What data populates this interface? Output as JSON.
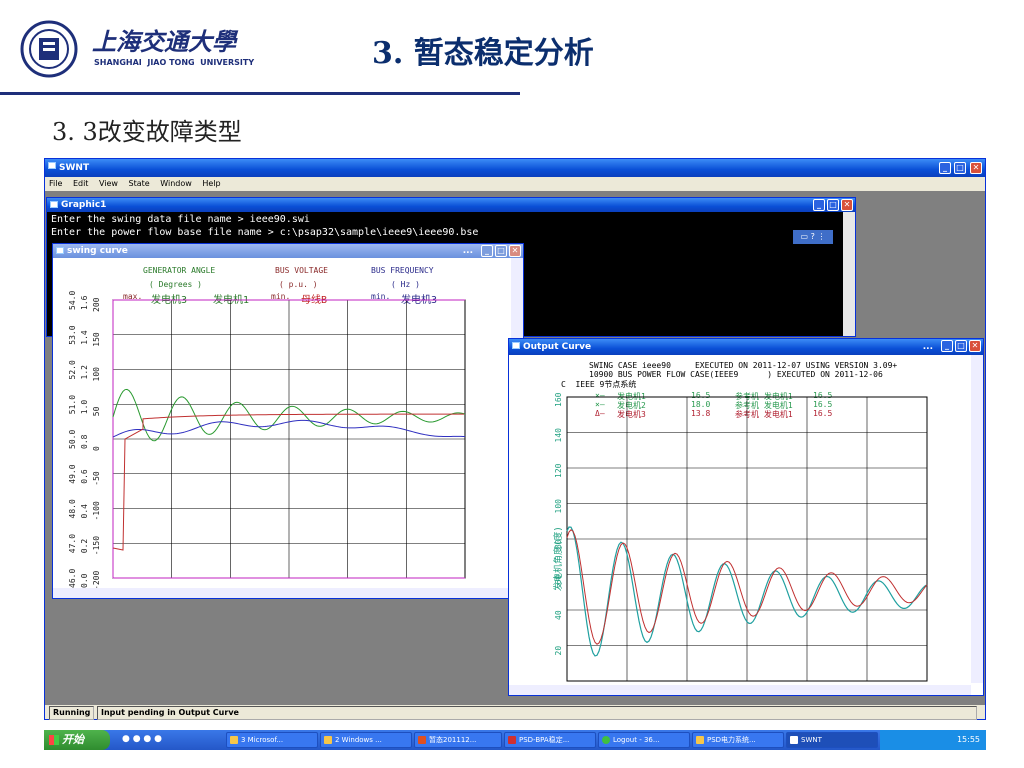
{
  "slide": {
    "logo_cn": "上海交通大學",
    "logo_en": "SHANGHAI  JIAO TONG  UNIVERSITY",
    "title": "3. 暂态稳定分析",
    "subtitle": "3. 3改变故障类型"
  },
  "app": {
    "title": "SWNT",
    "menu": [
      "File",
      "Edit",
      "View",
      "State",
      "Window",
      "Help"
    ],
    "status_state": "Running",
    "status_msg": "Input pending in Output Curve"
  },
  "graphic": {
    "title": "Graphic1",
    "line1": "Enter the swing data file name > ieee90.swi",
    "line2": "Enter the power flow base file name > c:\\psap32\\sample\\ieee9\\ieee90.bse",
    "mini_toolbar": "▭ ? ⋮"
  },
  "swing": {
    "title": "swing curve",
    "dots": "...",
    "col1_head": "GENERATOR ANGLE",
    "col1_unit": "( Degrees )",
    "col2_head": "BUS VOLTAGE",
    "col2_unit": "( p.u. )",
    "col3_head": "BUS FREQUENCY",
    "col3_unit": "( Hz )",
    "max_label": "max.",
    "gen3": "发电机3",
    "gen1": "发电机1",
    "min_label": "min.",
    "bus_b": "母线B",
    "min_label2": "min.",
    "gen3b": "发电机3",
    "axis_freq": [
      "54.0",
      "53.0",
      "52.0",
      "51.0",
      "50.0",
      "49.0",
      "48.0",
      "47.0",
      "46.0"
    ],
    "axis_volt": [
      "1.6",
      "1.4",
      "1.2",
      "1.0",
      "0.8",
      "0.6",
      "0.4",
      "0.2",
      "0.0"
    ],
    "axis_deg": [
      "200",
      "150",
      "100",
      "50",
      "0",
      "-50",
      "-100",
      "-150",
      "-200"
    ]
  },
  "output": {
    "title": "Output Curve",
    "dots": "...",
    "hdr1": "SWING CASE ieee90     EXECUTED ON 2011-12-07 USING VERSION 3.09+",
    "hdr2": "10900 BUS POWER FLOW CASE(IEEE9      ) EXECUTED ON 2011-12-06",
    "hdr3": "C  IEEE 9节点系统",
    "legend": [
      {
        "mark": "×—",
        "name": "发电机1",
        "val": "16.5",
        "ref": "参考机 发电机1",
        "v2": "16.5",
        "color": "#2a9a50"
      },
      {
        "mark": "×—",
        "name": "发电机2",
        "val": "18.0",
        "ref": "参考机 发电机1",
        "v2": "16.5",
        "color": "#2a9a50"
      },
      {
        "mark": "Δ—",
        "name": "发电机3",
        "val": "13.8",
        "ref": "参考机 发电机1",
        "v2": "16.5",
        "color": "#b02030"
      }
    ],
    "ylabel": "发电机角度(度)",
    "yticks": [
      "160",
      "140",
      "120",
      "100",
      "80",
      "60",
      "40",
      "20",
      "0"
    ]
  },
  "taskbar": {
    "start": "开始",
    "items": [
      "3 Microsof...",
      "2 Windows ...",
      "暂态201112...",
      "PSD-BPA稳定...",
      "Logout - 36...",
      "PSD电力系统...",
      "SWNT"
    ],
    "clock": "15:55"
  },
  "colors": {
    "titlebar": "#0a4fd6",
    "chart_red": "#c03030",
    "chart_green": "#2a9a30",
    "chart_blue": "#3030c0",
    "chart_cyan": "#20a0a0"
  }
}
